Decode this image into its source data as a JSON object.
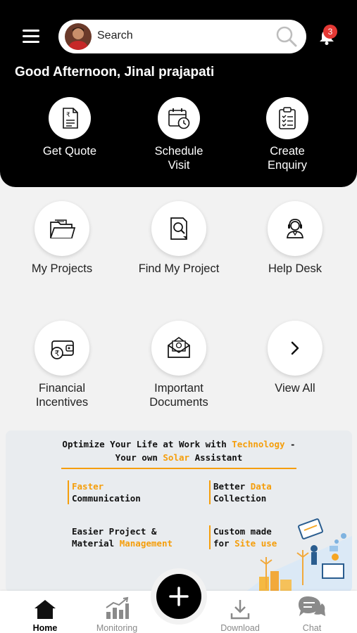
{
  "header": {
    "search_placeholder": "Search",
    "notification_count": "3",
    "greeting": "Good Afternoon, Jinal prajapati"
  },
  "quick_actions": [
    {
      "label": "Get Quote",
      "icon": "quote-document-icon"
    },
    {
      "label": "Schedule\nVisit",
      "icon": "calendar-clock-icon"
    },
    {
      "label": "Create\nEnquiry",
      "icon": "clipboard-checklist-icon"
    }
  ],
  "grid": [
    {
      "label": "My Projects",
      "icon": "folder-icon"
    },
    {
      "label": "Find My Project",
      "icon": "document-search-icon"
    },
    {
      "label": "Help Desk",
      "icon": "support-agent-icon"
    },
    {
      "label": "Financial\nIncentives",
      "icon": "wallet-rupee-icon"
    },
    {
      "label": "Important\nDocuments",
      "icon": "envelope-icon"
    },
    {
      "label": "View All",
      "icon": "chevron-right-icon"
    }
  ],
  "banner": {
    "title_line1_a": "Optimize Your Life at Work with ",
    "title_line1_b": "Technology",
    "title_line1_c": " -",
    "title_line2_a": "Your own ",
    "title_line2_b": "Solar",
    "title_line2_c": " Assistant",
    "f1_a": "Faster",
    "f1_b": "Communication",
    "f2_a": "Better ",
    "f2_b": "Data",
    "f2_c": "Collection",
    "f3_a": "Easier Project &",
    "f3_b": "Material ",
    "f3_c": "Management",
    "f4_a": "Custom made",
    "f4_b": "for ",
    "f4_c": "Site use"
  },
  "nav": {
    "home": "Home",
    "monitoring": "Monitoring",
    "download": "Download",
    "chat": "Chat"
  },
  "colors": {
    "accent": "#f59e0b",
    "header_bg": "#000000",
    "badge": "#e53935"
  }
}
